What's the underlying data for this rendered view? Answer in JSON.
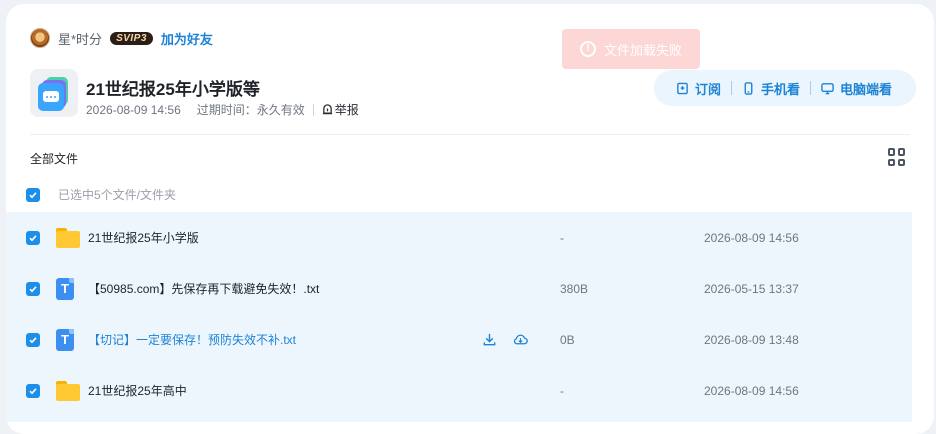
{
  "sharer": {
    "name": "星*时分",
    "badge": "SVIP3",
    "add_friend": "加为好友"
  },
  "toast": {
    "message": "文件加载失败",
    "icon": "alert-circle-icon"
  },
  "share": {
    "title": "21世纪报25年小学版等",
    "date": "2026-08-09 14:56",
    "expiry_label": "过期时间：永久有效",
    "report_label": "举报"
  },
  "actions": [
    {
      "label": "订阅",
      "icon": "subscribe-icon"
    },
    {
      "label": "手机看",
      "icon": "phone-icon"
    },
    {
      "label": "电脑端看",
      "icon": "monitor-icon"
    }
  ],
  "breadcrumb": {
    "root": "全部文件"
  },
  "selection": {
    "text": "已选中5个文件/文件夹"
  },
  "files": [
    {
      "name": "21世纪报25年小学版",
      "type": "folder",
      "size": "-",
      "date": "2026-08-09 14:56",
      "hovered": false
    },
    {
      "name": "【50985.com】先保存再下载避免失效！.txt",
      "type": "txt",
      "size": "380B",
      "date": "2026-05-15 13:37",
      "hovered": false
    },
    {
      "name": "【切记】一定要保存！预防失效不补.txt",
      "type": "txt",
      "size": "0B",
      "date": "2026-08-09 13:48",
      "hovered": true
    },
    {
      "name": "21世纪报25年高中",
      "type": "folder",
      "size": "-",
      "date": "2026-08-09 14:56",
      "hovered": false
    }
  ],
  "colors": {
    "accent": "#1d83d6",
    "checkbox": "#1d8fe8",
    "list_bg": "#eef6fd",
    "toast_bg": "#fdd6d6"
  }
}
